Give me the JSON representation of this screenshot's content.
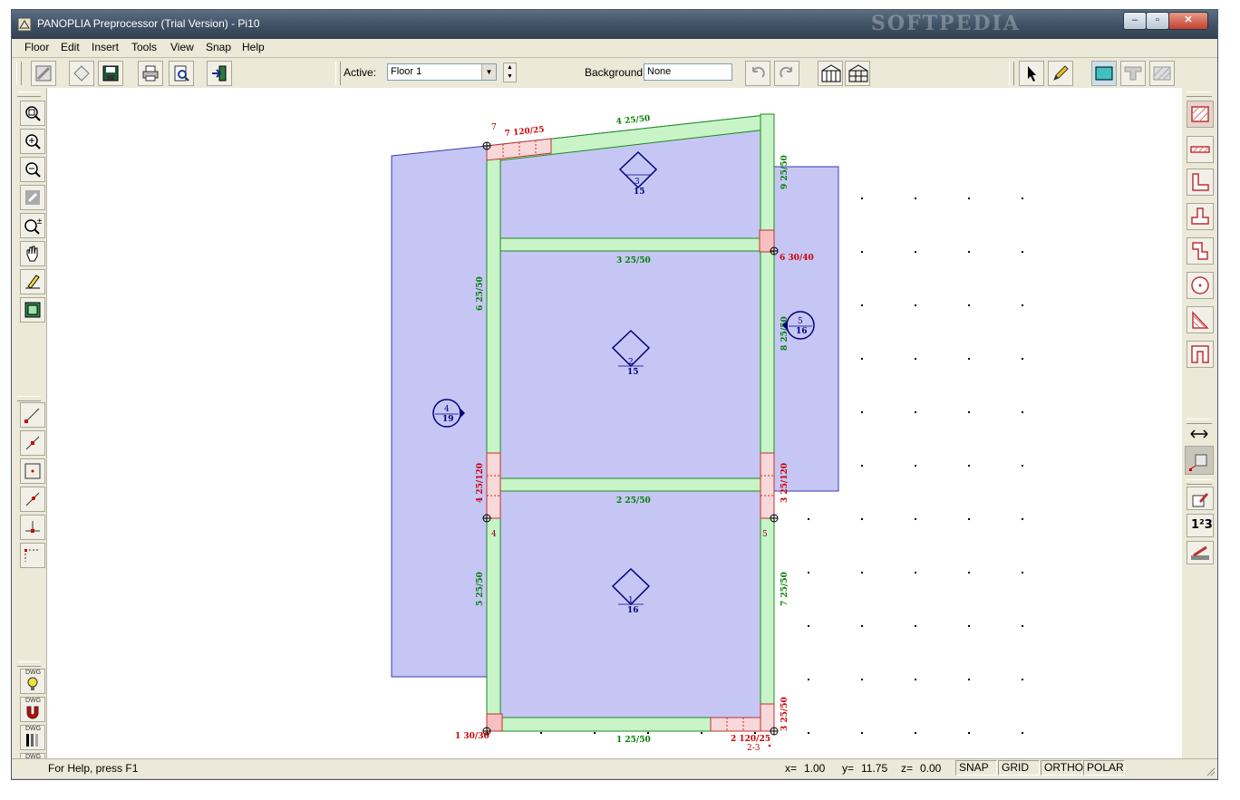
{
  "window": {
    "title": "PANOPLIA Preprocessor (Trial Version) - Pi10",
    "minimize": "–",
    "maximize": "▫",
    "close": "✕",
    "watermark": "SOFTPEDIA"
  },
  "menu": [
    "Floor",
    "Edit",
    "Insert",
    "Tools",
    "View",
    "Snap",
    "Help"
  ],
  "toolbar": {
    "active_label": "Active:",
    "floor_value": "Floor 1",
    "background_label": "Background:",
    "background_value": "None",
    "icons": [
      "wall-select-icon",
      "diamond-icon",
      "save-icon",
      "print-icon",
      "print-preview-icon",
      "exit-icon",
      "undo-icon",
      "redo-icon",
      "building-3d-icon",
      "building-wireframe-icon",
      "pointer-icon",
      "pencil-icon",
      "slab-view-icon",
      "beam-view-icon",
      "hatch-view-icon"
    ]
  },
  "left_tools": {
    "view": [
      "zoom-window-icon",
      "zoom-in-icon",
      "zoom-out-icon",
      "zoom-previous-icon",
      "zoom-realtime-icon",
      "pan-icon",
      "redraw-icon",
      "zoom-extents-icon"
    ],
    "snap": [
      "snap-endpoint-icon",
      "snap-midpoint-icon",
      "snap-center-icon",
      "snap-nearest-icon",
      "snap-perpendicular-icon",
      "snap-grid-icon"
    ],
    "dwg_label": "DWG",
    "dwg": [
      "dwg-light-icon",
      "dwg-magnet-icon",
      "dwg-layers-icon",
      "dwg-snap-icon"
    ]
  },
  "right_tools": {
    "elements": [
      "slab-icon",
      "beam-icon",
      "l-column-icon",
      "t-column-icon",
      "z-column-icon",
      "circular-column-icon",
      "triangular-column-icon",
      "u-column-icon"
    ],
    "extra": [
      "dimension-arrow-icon",
      "grid-box-icon",
      "edit-properties-icon",
      "numbering-icon",
      "foundation-icon"
    ],
    "numbering_text": "1²3"
  },
  "plan": {
    "colors": {
      "slab": "#c6c6f4",
      "slab_border": "#3a3ab0",
      "beam": "#c8f4c8",
      "beam_border": "#1e8a1e",
      "column": "#f8c8c8",
      "column_border": "#c03030",
      "beam_label": "#008000",
      "column_label": "#cc0000",
      "slab_label": "#000080"
    },
    "beam_labels": [
      {
        "id": "beam-4",
        "text": "4  25/50"
      },
      {
        "id": "beam-3",
        "text": "3  25/50"
      },
      {
        "id": "beam-2",
        "text": "2  25/50"
      },
      {
        "id": "beam-1",
        "text": "1  25/50"
      },
      {
        "id": "beam-6",
        "text": "6  25/50"
      },
      {
        "id": "beam-5",
        "text": "5  25/50"
      },
      {
        "id": "beam-9",
        "text": "9  25/50"
      },
      {
        "id": "beam-8",
        "text": "8  25/50"
      },
      {
        "id": "beam-7",
        "text": "7  25/50"
      }
    ],
    "column_labels": [
      {
        "id": "col-7",
        "text": "7   120/25"
      },
      {
        "id": "col-6",
        "text": "6  30/40"
      },
      {
        "id": "col-4",
        "text": "4  25/120"
      },
      {
        "id": "col-3",
        "text": "3  25/120"
      },
      {
        "id": "col-1",
        "text": "1  30/30"
      },
      {
        "id": "col-2",
        "text": "2   120/25"
      },
      {
        "id": "col-2-3",
        "text": "2-3"
      },
      {
        "id": "col-br",
        "text": "3  25/50"
      }
    ],
    "node_labels": [
      "7",
      "4",
      "5"
    ],
    "slabs": [
      {
        "id": "slab-1",
        "num": "1",
        "thk": "16"
      },
      {
        "id": "slab-2",
        "num": "2",
        "thk": "15"
      },
      {
        "id": "slab-3",
        "num": "3",
        "thk": "15"
      },
      {
        "id": "slab-4",
        "num": "4",
        "thk": "19"
      },
      {
        "id": "slab-5",
        "num": "5",
        "thk": "16"
      }
    ]
  },
  "status": {
    "help": "For Help, press F1",
    "x_label": "x=",
    "x_value": "1.00",
    "y_label": "y=",
    "y_value": "11.75",
    "z_label": "z=",
    "z_value": "0.00",
    "snap": "SNAP",
    "grid": "GRID",
    "ortho": "ORTHO",
    "polar": "POLAR"
  }
}
